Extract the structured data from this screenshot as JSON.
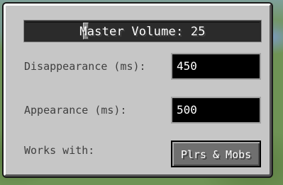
{
  "settings": {
    "master_volume": {
      "label": "Master Volume: 25",
      "level_percent": 25
    },
    "disappearance": {
      "label": "Disappearance (ms):",
      "value": "450"
    },
    "appearance": {
      "label": "Appearance (ms):",
      "value": "500"
    },
    "works_with": {
      "label": "Works with:",
      "button_label": "Plrs & Mobs"
    }
  },
  "colors": {
    "panel": "#c6c6c6",
    "field_bg": "#000000",
    "button_bg": "#6f6f6f",
    "label_text": "#404040"
  }
}
